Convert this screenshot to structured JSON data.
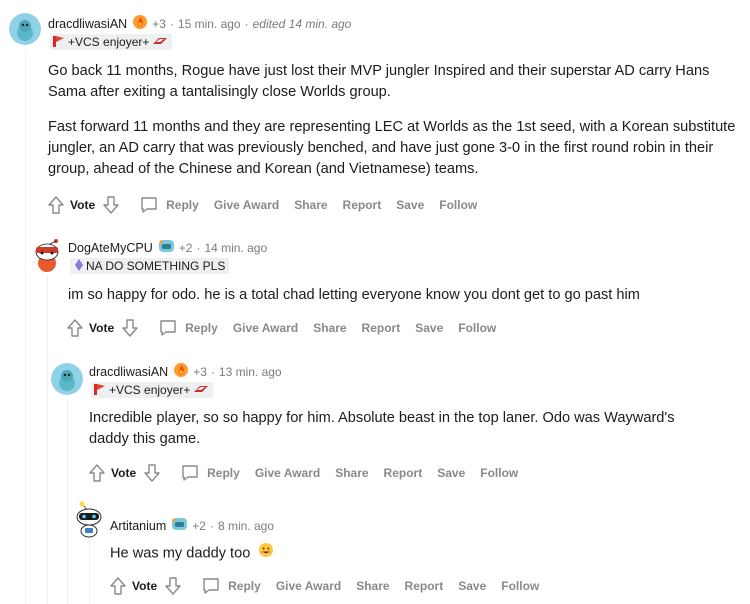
{
  "colors": {
    "username": "#1c1c1c",
    "meta": "#7c7c7c",
    "action": "#878a8c",
    "flair_bg": "#edeff1",
    "thread_line": "#edeff1"
  },
  "comments": [
    {
      "username": "dracdliwasiAN",
      "award_icon": "flame-award-icon",
      "award_count": "+3",
      "time": "15 min. ago",
      "edited": "edited 14 min. ago",
      "flair": "+VCS enjoyer+",
      "flair_icon": "vcs-flag-icon",
      "avatar_icon": "snoo-blue-avatar",
      "paragraphs": [
        "Go back 11 months, Rogue have just lost their MVP jungler Inspired and their superstar AD carry Hans Sama after exiting a tantalisingly close Worlds group.",
        "Fast forward 11 months and they are representing LEC at Worlds as the 1st seed, with a Korean substitute jungler, an AD carry that was previously benched, and have just gone 3-0 in the first round robin in their group, ahead of the Chinese and Korean (and Vietnamese) teams."
      ]
    },
    {
      "username": "DogAteMyCPU",
      "award_icon": "helmet-award-icon",
      "award_count": "+2",
      "time": "14 min. ago",
      "flair": "NA DO SOMETHING PLS",
      "flair_icon": "diamond-icon",
      "avatar_icon": "snoo-red-avatar",
      "paragraphs": [
        "im so happy for odo. he is a total chad letting everyone know you dont get to go past him"
      ]
    },
    {
      "username": "dracdliwasiAN",
      "award_icon": "flame-award-icon",
      "award_count": "+3",
      "time": "13 min. ago",
      "flair": "+VCS enjoyer+",
      "flair_icon": "vcs-flag-icon",
      "avatar_icon": "snoo-blue-avatar",
      "paragraphs": [
        "Incredible player, so so happy for him. Absolute beast in the top laner. Odo was Wayward's daddy this game."
      ]
    },
    {
      "username": "Artitanium",
      "award_icon": "helmet-award-icon",
      "award_count": "+2",
      "time": "8 min. ago",
      "avatar_icon": "snoo-robot-avatar",
      "paragraphs": [
        "He was my daddy too"
      ],
      "emoji_icon": "grinning-emoji-icon"
    }
  ],
  "actions": {
    "vote": "Vote",
    "reply": "Reply",
    "give_award": "Give Award",
    "share": "Share",
    "report": "Report",
    "save": "Save",
    "follow": "Follow"
  },
  "separator": "·"
}
